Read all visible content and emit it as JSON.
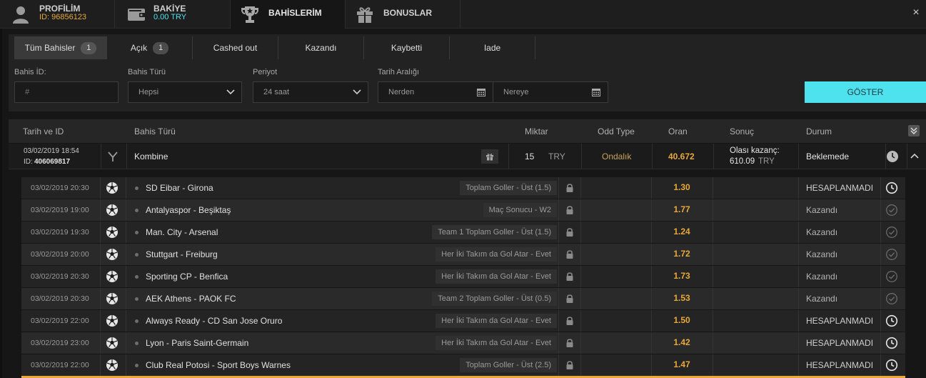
{
  "topbar": {
    "tabs": [
      {
        "title": "PROFİLİM",
        "sub": "ID: 96856123",
        "sub_color": "#e8a83a",
        "icon": "user-icon"
      },
      {
        "title": "BAKİYE",
        "sub": "0.00 TRY",
        "sub_color": "#4ee1ee",
        "icon": "wallet-icon"
      },
      {
        "title": "BAHİSLERİM",
        "sub": "",
        "icon": "trophy-icon"
      },
      {
        "title": "BONUSLAR",
        "sub": "",
        "icon": "gift-icon"
      }
    ],
    "close_label": "×"
  },
  "filter_tabs": [
    {
      "label": "Tüm Bahisler",
      "count": "1"
    },
    {
      "label": "Açık",
      "count": "1"
    },
    {
      "label": "Cashed out"
    },
    {
      "label": "Kazandı"
    },
    {
      "label": "Kaybetti"
    },
    {
      "label": "Iade"
    }
  ],
  "filters": {
    "bet_id_label": "Bahis İD:",
    "bet_id_placeholder": "#",
    "bet_type_label": "Bahis Türü",
    "bet_type_value": "Hepsi",
    "period_label": "Periyot",
    "period_value": "24 saat",
    "date_range_label": "Tarih Aralığı",
    "from_placeholder": "Nerden",
    "to_placeholder": "Nereye",
    "show_button": "GÖSTER"
  },
  "columns": {
    "date_id": "Tarih ve ID",
    "bet_type": "Bahis Türü",
    "amount": "Miktar",
    "odd_type": "Odd Type",
    "odds": "Oran",
    "result": "Sonuç",
    "status": "Durum"
  },
  "main_bet": {
    "date": "03/02/2019 18:54",
    "id_prefix": "ID:",
    "id": "406069817",
    "type": "Kombine",
    "amount": "15",
    "currency": "TRY",
    "odd_type": "Ondalık",
    "odds": "40.672",
    "result_label": "Olası kazanç:",
    "result_value": "610.09",
    "result_currency": "TRY",
    "status": "Beklemede"
  },
  "selections": [
    {
      "date": "03/02/2019 20:30",
      "match": "SD Eibar - Girona",
      "market": "Toplam Goller - Üst (1.5)",
      "odds": "1.30",
      "status": "HESAPLANMADI",
      "state": "pending"
    },
    {
      "date": "03/02/2019 19:00",
      "match": "Antalyaspor - Beşiktaş",
      "market": "Maç Sonucu - W2",
      "odds": "1.77",
      "status": "Kazandı",
      "state": "won"
    },
    {
      "date": "03/02/2019 19:30",
      "match": "Man. City - Arsenal",
      "market": "Team 1 Toplam Goller - Üst (1.5)",
      "odds": "1.24",
      "status": "Kazandı",
      "state": "won"
    },
    {
      "date": "03/02/2019 20:00",
      "match": "Stuttgart - Freiburg",
      "market": "Her İki Takım da Gol Atar - Evet",
      "odds": "1.72",
      "status": "Kazandı",
      "state": "won"
    },
    {
      "date": "03/02/2019 20:30",
      "match": "Sporting CP - Benfica",
      "market": "Her İki Takım da Gol Atar - Evet",
      "odds": "1.73",
      "status": "Kazandı",
      "state": "won"
    },
    {
      "date": "03/02/2019 20:30",
      "match": "AEK Athens - PAOK FC",
      "market": "Team 2 Toplam Goller - Üst (0.5)",
      "odds": "1.53",
      "status": "Kazandı",
      "state": "won"
    },
    {
      "date": "03/02/2019 22:00",
      "match": "Always Ready - CD San Jose Oruro",
      "market": "Her İki Takım da Gol Atar - Evet",
      "odds": "1.50",
      "status": "HESAPLANMADI",
      "state": "pending"
    },
    {
      "date": "03/02/2019 23:00",
      "match": "Lyon - Paris Saint-Germain",
      "market": "Her İki Takım da Gol Atar - Evet",
      "odds": "1.42",
      "status": "HESAPLANMADI",
      "state": "pending"
    },
    {
      "date": "03/02/2019 22:00",
      "match": "Club Real Potosi - Sport Boys Warnes",
      "market": "Toplam Goller - Üst (2.5)",
      "odds": "1.47",
      "status": "HESAPLANMADI",
      "state": "pending"
    }
  ],
  "colors": {
    "accent": "#e8a83a",
    "cyan": "#4ee1ee"
  }
}
